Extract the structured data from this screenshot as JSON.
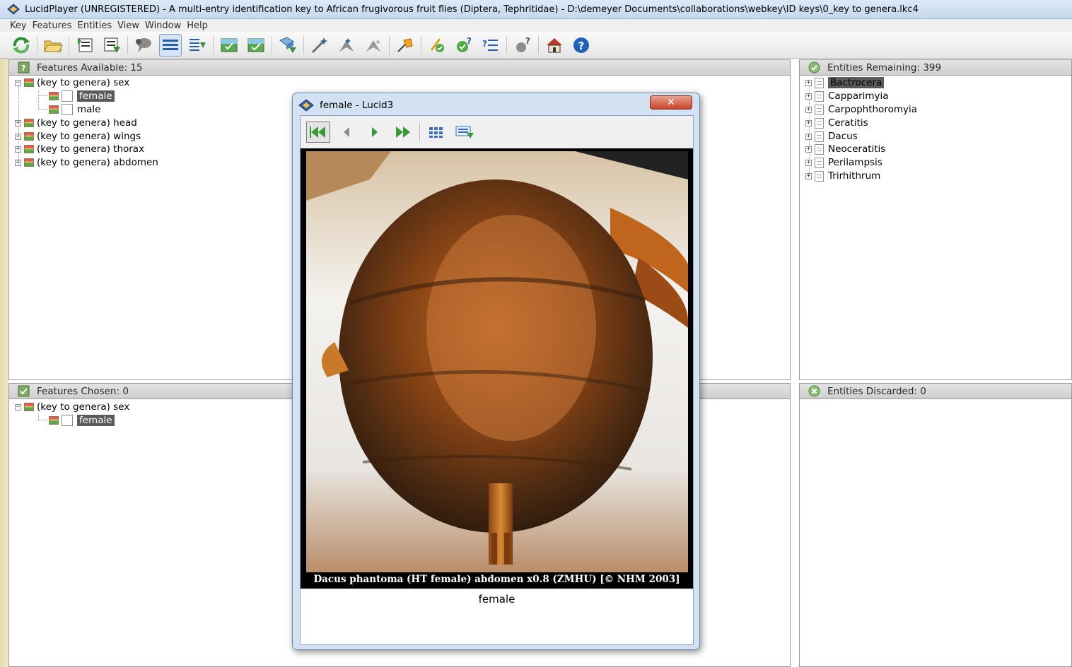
{
  "window": {
    "title": "LucidPlayer (UNREGISTERED) - A multi-entry identification key to African frugivorous fruit flies (Diptera, Tephritidae) - D:\\demeyer Documents\\collaborations\\webkey\\ID keys\\0_key to genera.lkc4"
  },
  "menu": [
    "Key",
    "Features",
    "Entities",
    "View",
    "Window",
    "Help"
  ],
  "toolbar_icons": [
    "restart-icon",
    "open-folder-icon",
    "promote-icon",
    "expand-icon",
    "comment-icon",
    "list-view-icon",
    "collapse-list-icon",
    "image-view-icon",
    "image-view-alt-icon",
    "sort-icon",
    "magic-wand-icon",
    "best-icon",
    "prune-icon",
    "pin-icon",
    "differences-icon",
    "what-icon",
    "checklist-icon",
    "find-icon",
    "home-icon",
    "help-icon"
  ],
  "features_available": {
    "header": "Features Available: 15",
    "items": [
      {
        "label": "(key to genera) sex"
      },
      {
        "label": "female"
      },
      {
        "label": "male"
      },
      {
        "label": "(key to genera) head"
      },
      {
        "label": "(key to genera) wings"
      },
      {
        "label": "(key to genera) thorax"
      },
      {
        "label": "(key to genera) abdomen"
      }
    ]
  },
  "features_chosen": {
    "header": "Features Chosen: 0",
    "items": [
      {
        "label": "(key to genera) sex"
      },
      {
        "label": "female"
      }
    ]
  },
  "entities_remaining": {
    "header": "Entities Remaining: 399",
    "items": [
      "Bactrocera",
      "Capparimyia",
      "Carpophthoromyia",
      "Ceratitis",
      "Dacus",
      "Neoceratitis",
      "Perilampsis",
      "Trirhithrum"
    ]
  },
  "entities_discarded": {
    "header": "Entities Discarded: 0"
  },
  "dialog": {
    "title": "female - Lucid3",
    "close_label": "✕",
    "caption": "Dacus phantoma (HT female) abdomen x0.8 (ZMHU) [© NHM 2003]",
    "label": "female"
  },
  "colors": {
    "selection": "#5a5a5a",
    "panel_header": "#d8d8d8",
    "accent_blue": "#1f63b8",
    "abdomen_brown": "#7a3d14"
  }
}
